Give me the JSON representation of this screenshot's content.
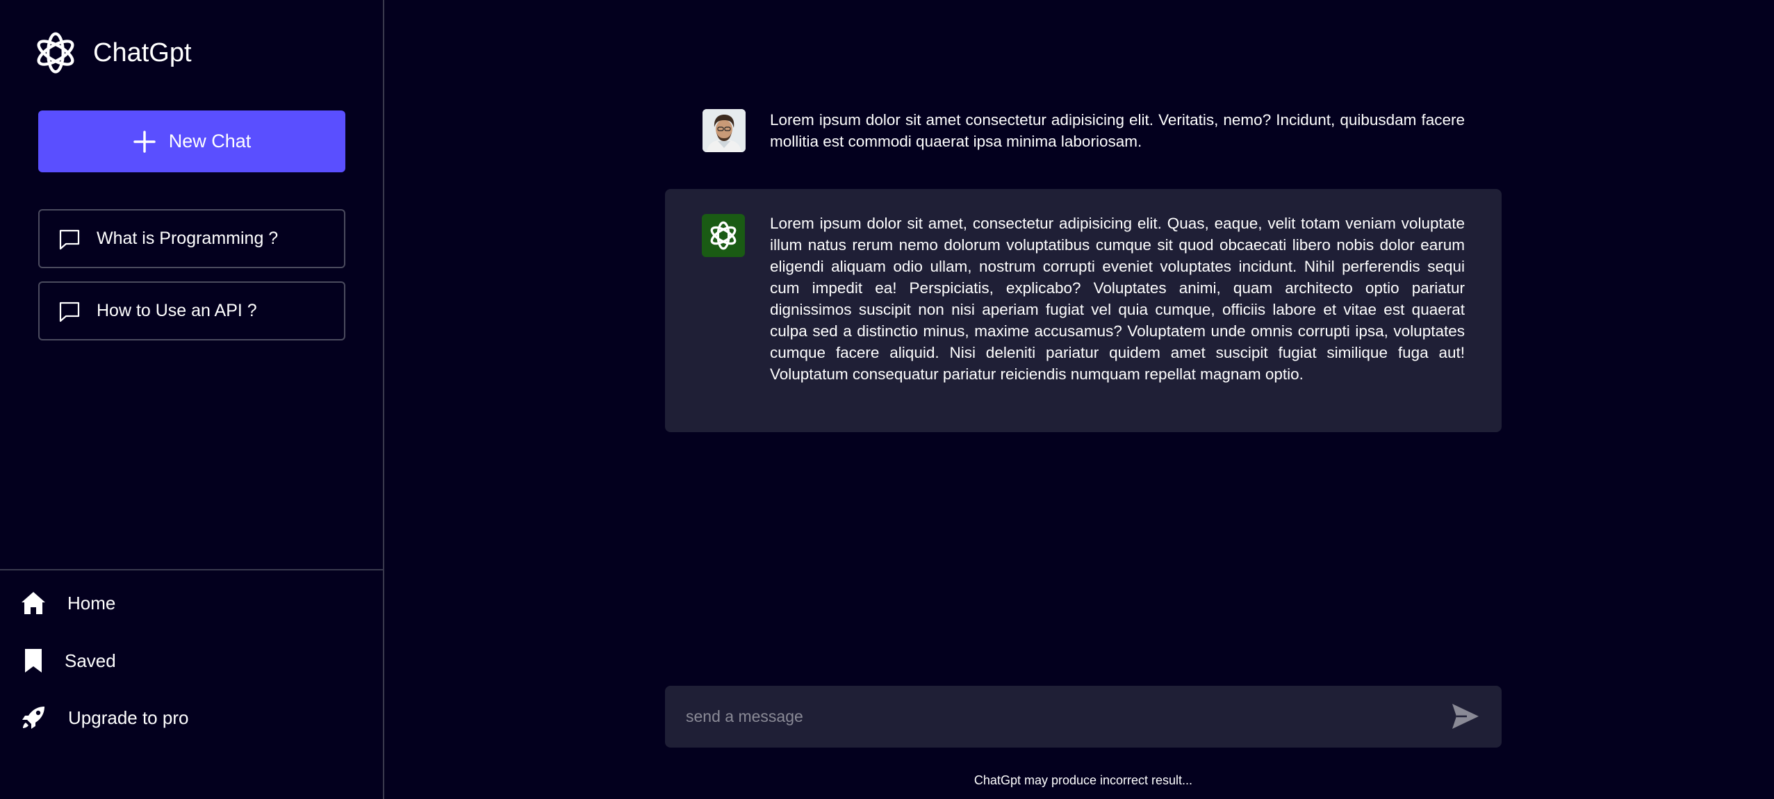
{
  "app": {
    "name": "ChatGpt"
  },
  "sidebar": {
    "new_chat_label": "New Chat",
    "history": [
      {
        "label": "What is Programming ?"
      },
      {
        "label": "How to Use an API ?"
      }
    ],
    "nav": [
      {
        "label": "Home",
        "icon": "home-icon"
      },
      {
        "label": "Saved",
        "icon": "bookmark-icon"
      },
      {
        "label": "Upgrade to pro",
        "icon": "rocket-icon"
      }
    ]
  },
  "conversation": {
    "messages": [
      {
        "role": "user",
        "text": "Lorem ipsum dolor sit amet consectetur adipisicing elit. Veritatis, nemo? Incidunt, quibusdam facere mollitia est commodi quaerat ipsa minima laboriosam."
      },
      {
        "role": "assistant",
        "text": "Lorem ipsum dolor sit amet, consectetur adipisicing elit. Quas, eaque, velit totam veniam voluptate illum natus rerum nemo dolorum voluptatibus cumque sit quod obcaecati libero nobis dolor earum eligendi aliquam odio ullam, nostrum corrupti eveniet voluptates incidunt. Nihil perferendis sequi cum impedit ea! Perspiciatis, explicabo? Voluptates animi, quam architecto optio pariatur dignissimos suscipit non nisi aperiam fugiat vel quia cumque, officiis labore et vitae est quaerat culpa sed a distinctio minus, maxime accusamus? Voluptatem unde omnis corrupti ipsa, voluptates cumque facere aliquid. Nisi deleniti pariatur quidem amet suscipit fugiat similique fuga aut! Voluptatum consequatur pariatur reiciendis numquam repellat magnam optio."
      }
    ]
  },
  "composer": {
    "placeholder": "send a message",
    "disclaimer": "ChatGpt may produce incorrect result..."
  },
  "colors": {
    "background": "#03001e",
    "accent": "#5a4fff",
    "panel": "#1f1f36",
    "bot_avatar": "#1a5b14"
  }
}
